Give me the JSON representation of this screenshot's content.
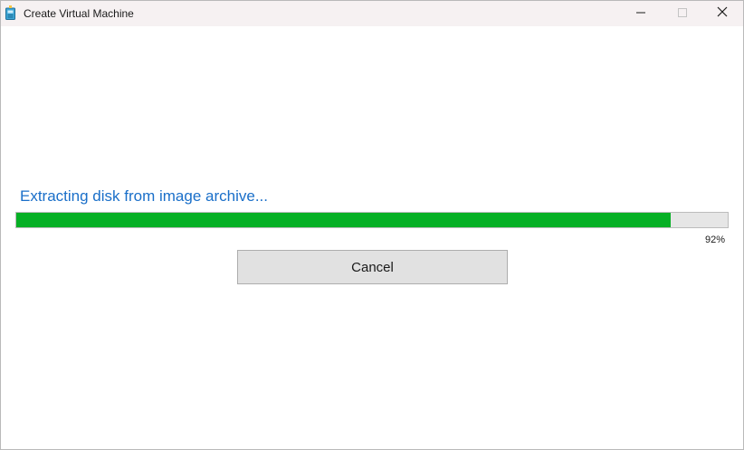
{
  "window": {
    "title": "Create Virtual Machine",
    "title_icon": "vm-app-icon",
    "caption_buttons": {
      "minimize_icon": "minimize-icon",
      "maximize_icon": "maximize-icon",
      "close_icon": "close-icon"
    }
  },
  "main": {
    "status_text": "Extracting disk from image archive...",
    "progress": {
      "percent": 92,
      "label": "92%",
      "fill_color": "#06b025",
      "track_color": "#e6e6e6"
    },
    "cancel_label": "Cancel"
  },
  "colors": {
    "status_text": "#1a6fc9",
    "titlebar_bg": "#f6f1f2",
    "button_bg": "#e1e1e1"
  }
}
